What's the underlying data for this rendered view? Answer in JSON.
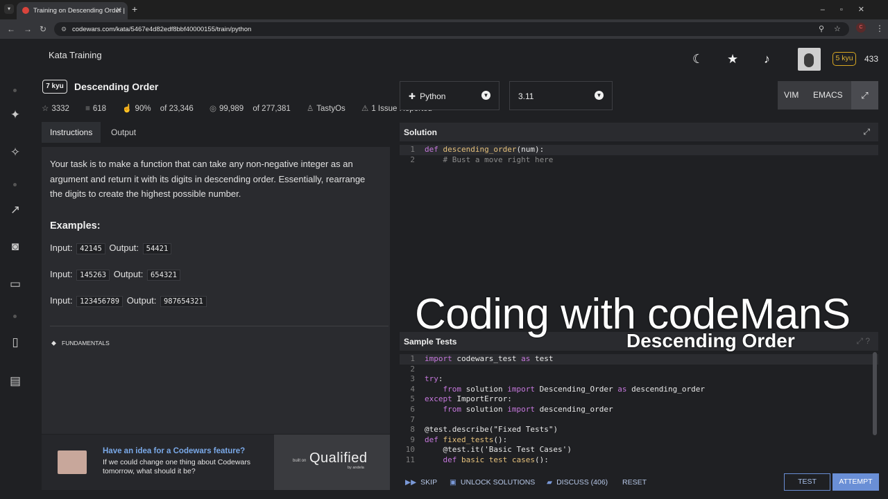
{
  "browser": {
    "tab_title": "Training on Descending Order |",
    "url": "codewars.com/kata/5467e4d82edf8bbf40000155/train/python",
    "profile_initial": "C"
  },
  "header": {
    "section": "Kata Training",
    "rank": "5 kyu",
    "honor": "433"
  },
  "kata": {
    "rank": "7 kyu",
    "title": "Descending Order",
    "stats": {
      "stars": "3332",
      "collections": "618",
      "satisfaction_pct": "90%",
      "satisfaction_of": "of 23,346",
      "completed": "99,989",
      "completed_of": "of 277,381",
      "author": "TastyOs",
      "issues": "1 Issue Reported"
    },
    "tabs": [
      "Instructions",
      "Output"
    ],
    "description": [
      "Your task is to make a function that can take any non-negative integer as an",
      "argument and return it with its digits in descending order. Essentially, rearrange",
      "the digits to create the highest possible number."
    ],
    "examples_heading": "Examples:",
    "examples": [
      {
        "input": "42145",
        "output": "54421"
      },
      {
        "input": "145263",
        "output": "654321"
      },
      {
        "input": "123456789",
        "output": "987654321"
      }
    ],
    "input_label": "Input:",
    "output_label": "Output:",
    "tag": "FUNDAMENTALS"
  },
  "promo": {
    "heading": "Have an idea for a Codewars feature?",
    "text": "If we could change one thing about Codewars tomorrow, what should it be?",
    "built_on": "built on",
    "brand": "Qualified",
    "by": "by andela"
  },
  "editor": {
    "language": "Python",
    "version": "3.11",
    "mode_vim": "VIM",
    "mode_emacs": "EMACS",
    "solution_title": "Solution",
    "tests_title": "Sample Tests",
    "solution_lines": [
      "def descending_order(num):",
      "    # Bust a move right here"
    ],
    "test_lines": [
      "import codewars_test as test",
      "",
      "try:",
      "    from solution import Descending_Order as descending_order",
      "except ImportError:",
      "    from solution import descending_order",
      "",
      "@test.describe(\"Fixed Tests\")",
      "def fixed_tests():",
      "    @test.it('Basic Test Cases')",
      "    def basic_test_cases():"
    ]
  },
  "actions": {
    "skip": "SKIP",
    "unlock": "UNLOCK SOLUTIONS",
    "discuss": "DISCUSS (406)",
    "reset": "RESET",
    "test": "TEST",
    "attempt": "ATTEMPT"
  },
  "overlay": {
    "title": "Coding with codeManS",
    "subtitle": "Descending Order"
  },
  "colors": {
    "accent": "#6a8fd6",
    "brand": "#c9332d",
    "rank_gold": "#d8a722"
  }
}
